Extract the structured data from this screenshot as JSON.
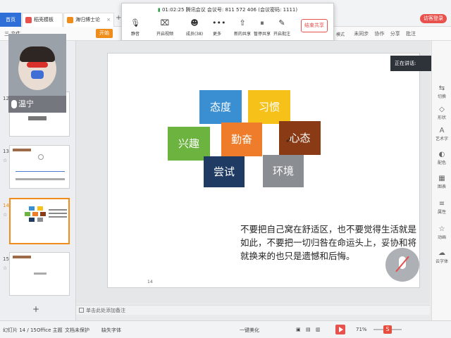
{
  "titlebar": {
    "home_tab": "首页",
    "tabs": [
      {
        "label": "稻壳模板",
        "color": "#e9514d"
      },
      {
        "label": "海归博士论坛.pptx",
        "color": "#f08c1a"
      }
    ],
    "login": "访客登录"
  },
  "ribbon": {
    "menu": "三 文件",
    "start": "开始",
    "mode": "模式",
    "right_items": [
      "未同步",
      "协作",
      "分享",
      "批注"
    ]
  },
  "meeting": {
    "time": "01:02:25",
    "name": "腾讯会议",
    "meeting_id": "会议号: 811 572 406",
    "password": "(会议密码: 1111)",
    "tools": [
      {
        "label": "静音",
        "icon": "mic-icon"
      },
      {
        "label": "开启视频",
        "icon": "video-off-icon"
      },
      {
        "label": "成员(38)",
        "icon": "members-icon"
      },
      {
        "label": "更多",
        "icon": "more-icon"
      },
      {
        "label": "新的共享",
        "icon": "share-new-icon"
      },
      {
        "label": "暂停共享",
        "icon": "pause-share-icon"
      },
      {
        "label": "开启批注",
        "icon": "annotate-icon"
      }
    ],
    "end_share": "结束共享"
  },
  "video": {
    "name": "温宁"
  },
  "speaking": "正在讲话:",
  "slides_panel": {
    "items": [
      {
        "num": "12",
        "star": "",
        "active": false
      },
      {
        "num": "13",
        "star": "☆",
        "active": false
      },
      {
        "num": "14",
        "star": "☆",
        "active": true
      },
      {
        "num": "15",
        "star": "☆",
        "active": false
      }
    ],
    "add": "+"
  },
  "slide": {
    "boxes": [
      {
        "text": "态度",
        "color": "#3a8fd2"
      },
      {
        "text": "习惯",
        "color": "#f6c21a"
      },
      {
        "text": "兴趣",
        "color": "#6cb33f"
      },
      {
        "text": "勤奋",
        "color": "#ef7c2a"
      },
      {
        "text": "心态",
        "color": "#8b3a16"
      },
      {
        "text": "尝试",
        "color": "#1f3a63"
      },
      {
        "text": "环境",
        "color": "#8a8d92"
      }
    ],
    "text": "不要把自己窝在舒适区，也不要觉得生活就是如此，不要把一切归咎在命运头上，妥协和将就换来的也只是遗憾和后悔。",
    "page_number": "14"
  },
  "notes": "单击此处添加备注",
  "right_sidebar": [
    {
      "label": "切换",
      "icon": "transition-icon"
    },
    {
      "label": "形状",
      "icon": "shape-icon"
    },
    {
      "label": "艺术字",
      "icon": "wordart-icon"
    },
    {
      "label": "配色",
      "icon": "palette-icon"
    },
    {
      "label": "图表",
      "icon": "chart-icon"
    },
    {
      "label": "属性",
      "icon": "properties-icon"
    },
    {
      "label": "动画",
      "icon": "animation-icon"
    },
    {
      "label": "云字体",
      "icon": "cloud-font-icon"
    }
  ],
  "status": {
    "slide_count": "幻灯片 14 / 15",
    "theme": "Office 主题",
    "unprotected": "文档未保护",
    "font_missing": "缺失字体",
    "beautify": "一键美化",
    "zoom": "71%"
  }
}
